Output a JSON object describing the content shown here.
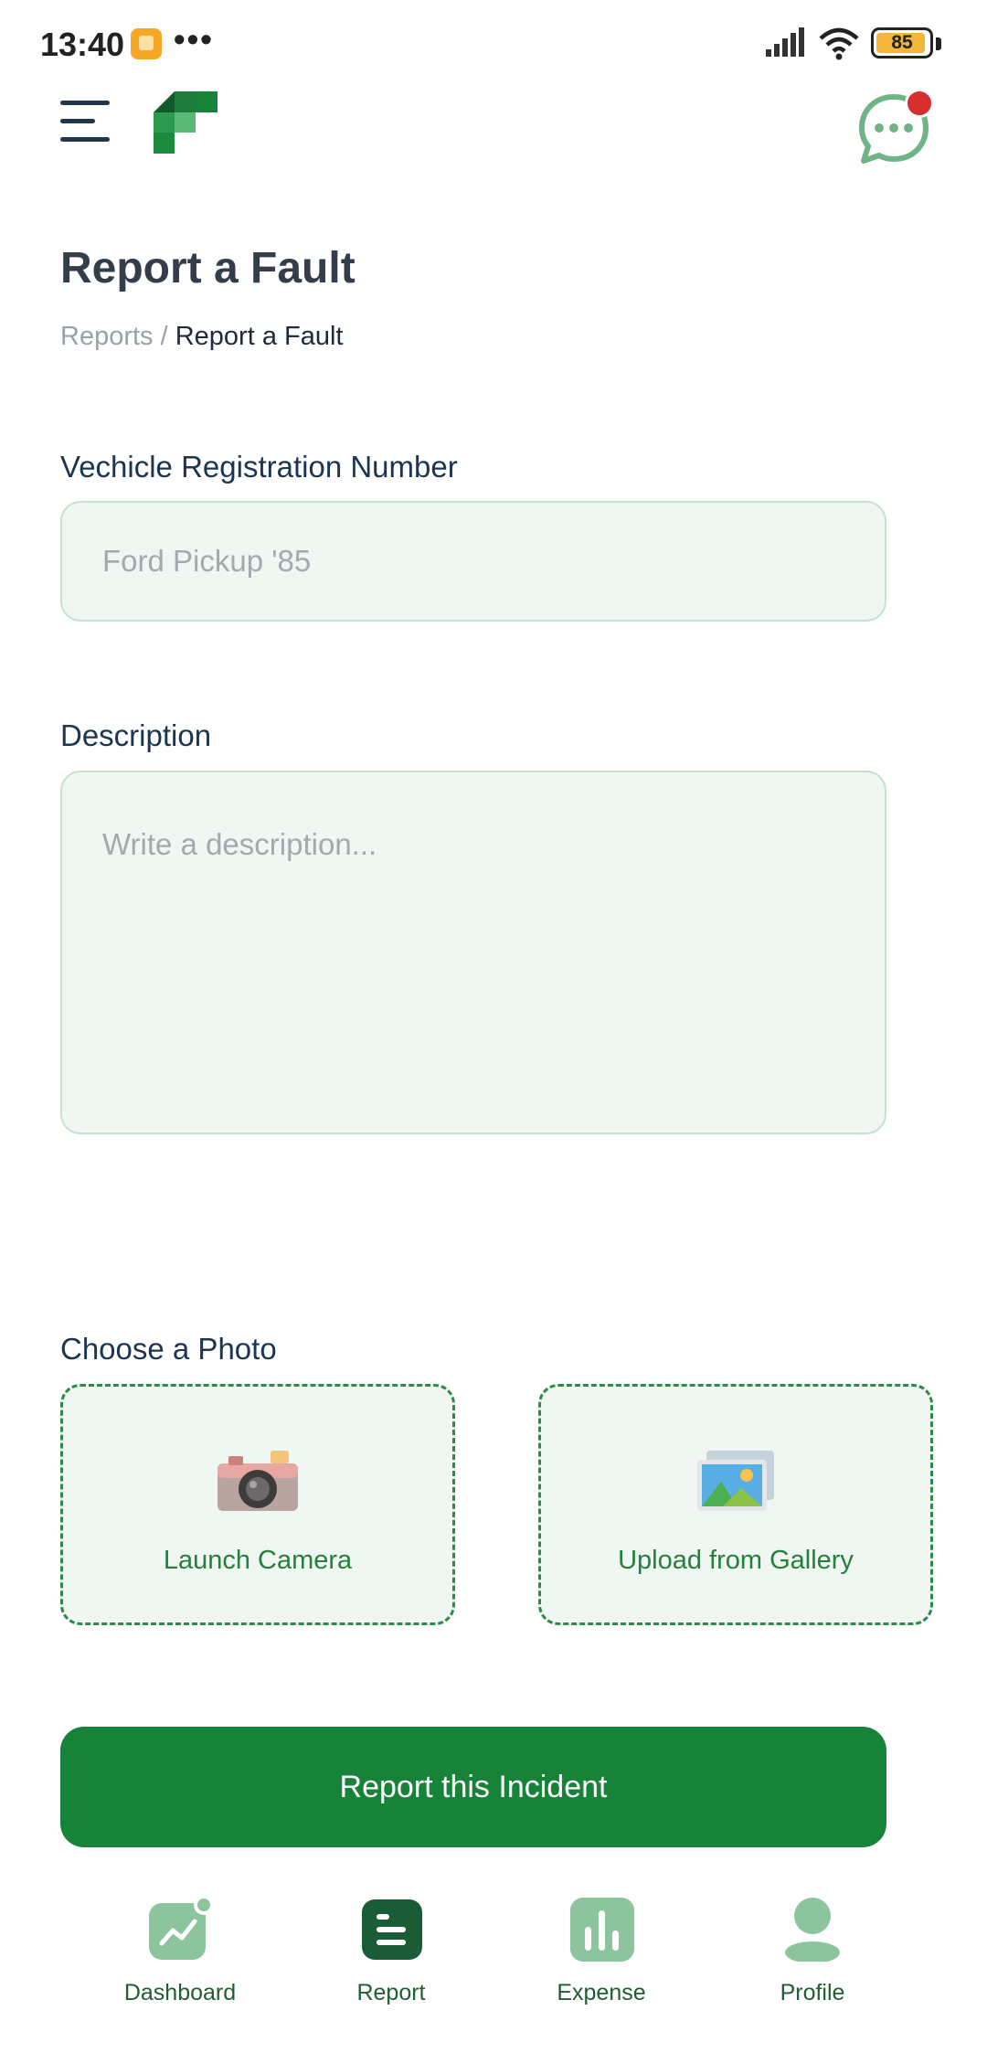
{
  "status_bar": {
    "time": "13:40",
    "overflow": "•••",
    "battery_level": "85",
    "icons": [
      "app-notification-icon",
      "signal-icon",
      "wifi-icon",
      "battery-icon"
    ]
  },
  "app_bar": {
    "menu_icon": "menu-icon",
    "logo": "brand-logo",
    "chat_icon": "chat-bubble-icon",
    "has_notification": true
  },
  "page": {
    "title": "Report a Fault",
    "breadcrumb": {
      "root": "Reports",
      "separator": " / ",
      "current": "Report a Fault"
    }
  },
  "form": {
    "vehicle": {
      "label": "Vechicle Registration Number",
      "placeholder": "Ford Pickup '85",
      "value": ""
    },
    "description": {
      "label": "Description",
      "placeholder": "Write a description...",
      "value": ""
    },
    "photo": {
      "label": "Choose a Photo",
      "camera_label": "Launch Camera",
      "gallery_label": "Upload from Gallery",
      "camera_icon": "camera-icon",
      "gallery_icon": "picture-icon"
    },
    "submit_label": "Report this Incident"
  },
  "bottom_nav": {
    "items": [
      {
        "label": "Dashboard",
        "icon": "trend-chart-icon",
        "active": false
      },
      {
        "label": "Report",
        "icon": "report-list-icon",
        "active": true
      },
      {
        "label": "Expense",
        "icon": "bar-chart-icon",
        "active": false
      },
      {
        "label": "Profile",
        "icon": "user-icon",
        "active": false
      }
    ]
  },
  "colors": {
    "primary": "#178338",
    "primary_dark": "#1a5c36",
    "primary_light": "#8cc49d",
    "field_bg": "#f0f7f2",
    "field_border": "#c5e2cc",
    "notification": "#d62d2d"
  }
}
